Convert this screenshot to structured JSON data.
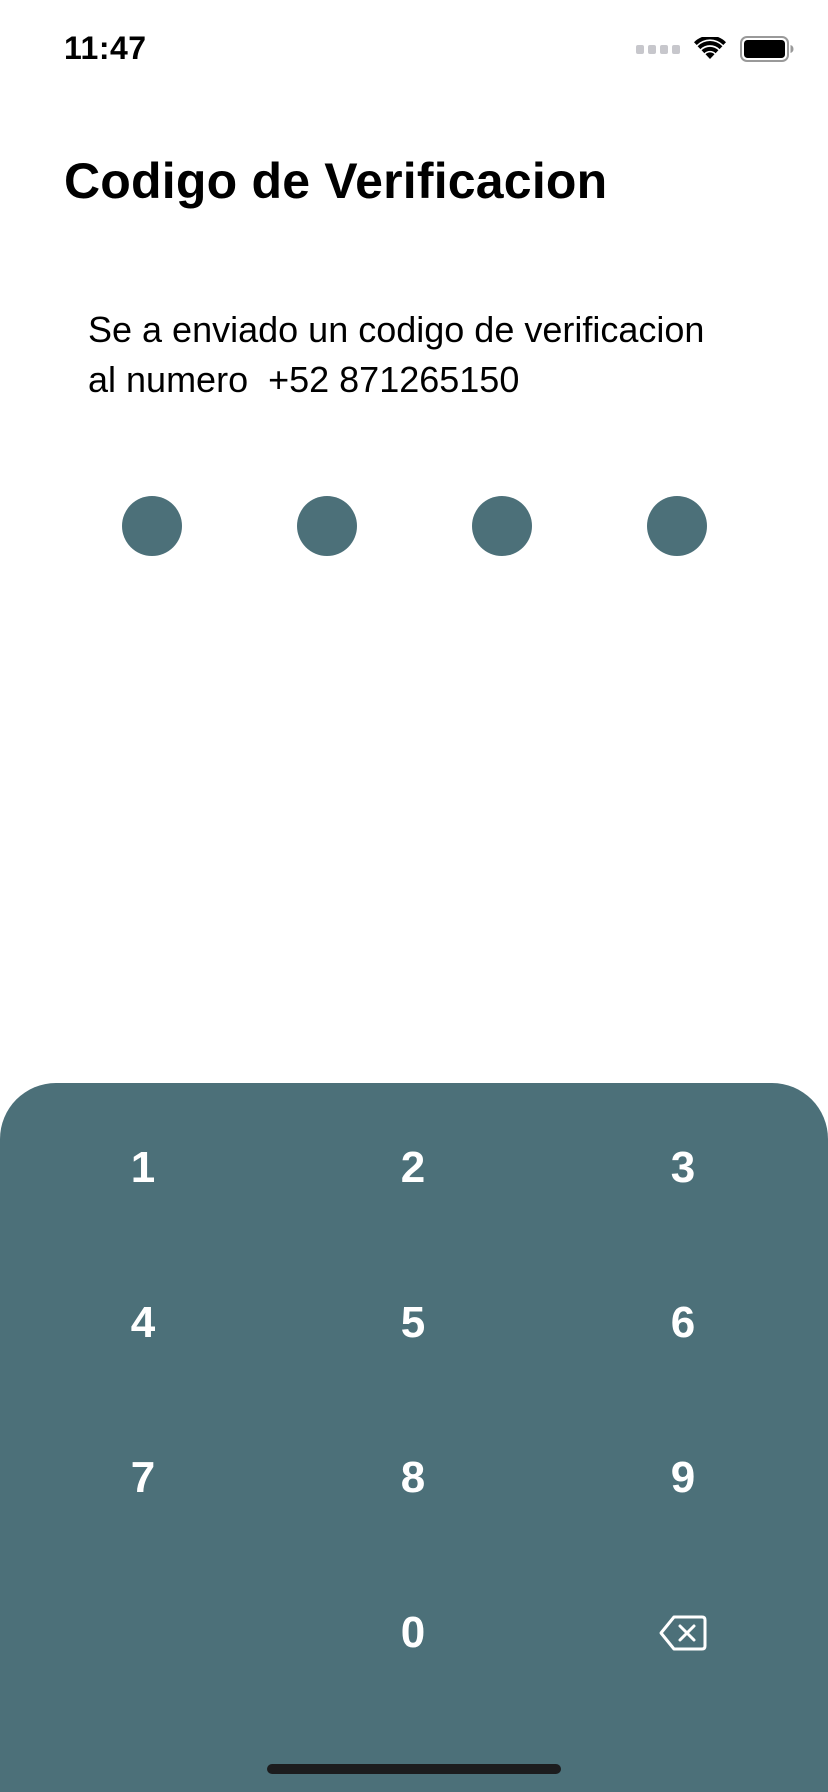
{
  "status_bar": {
    "time": "11:47",
    "signal_icon": "cellular-signal-icon",
    "wifi_icon": "wifi-icon",
    "battery_icon": "battery-icon"
  },
  "title": "Codigo de Verificacion",
  "message": {
    "line1": "Se a enviado un codigo de verificacion",
    "line2": "al numero  +52 871265150"
  },
  "pin": {
    "length": 4,
    "dot_color": "#4c7079"
  },
  "keypad": {
    "background_color": "#4c7079",
    "keys": [
      "1",
      "2",
      "3",
      "4",
      "5",
      "6",
      "7",
      "8",
      "9",
      "0"
    ],
    "backspace_icon": "backspace-icon"
  }
}
